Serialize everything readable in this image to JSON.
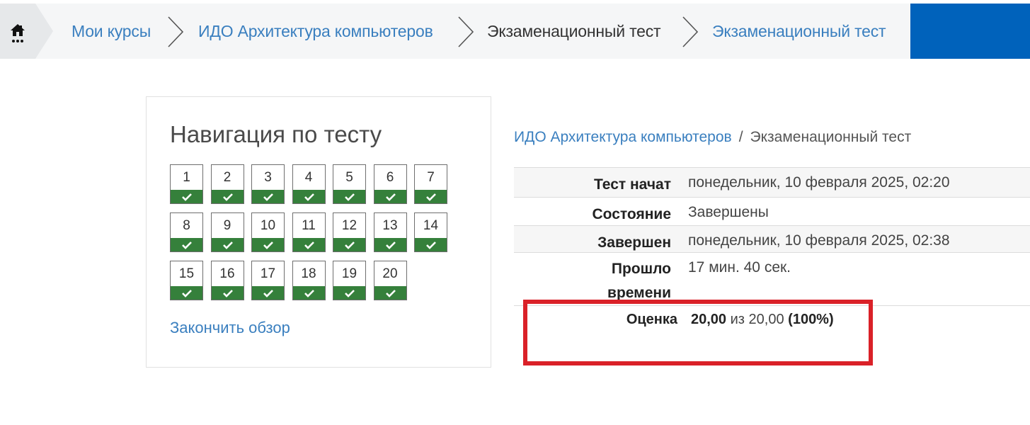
{
  "breadcrumb": {
    "items": [
      {
        "label": "Мои курсы",
        "type": "link"
      },
      {
        "label": "ИДО Архитектура компьютеров",
        "type": "link"
      },
      {
        "label": "Экзаменационный тест",
        "type": "current"
      },
      {
        "label": "Экзаменационный тест",
        "type": "link"
      }
    ]
  },
  "icons": {
    "home": "home-icon",
    "separator": "chevron-right-icon",
    "question_state": "check-icon"
  },
  "colors": {
    "link": "#3a7fbf",
    "brand": "#0062bb",
    "answered": "#35803b",
    "highlight": "#da2128"
  },
  "quiz_navigation": {
    "title": "Навигация по тесту",
    "questions": [
      {
        "number": "1",
        "state": "answered"
      },
      {
        "number": "2",
        "state": "answered"
      },
      {
        "number": "3",
        "state": "answered"
      },
      {
        "number": "4",
        "state": "answered"
      },
      {
        "number": "5",
        "state": "answered"
      },
      {
        "number": "6",
        "state": "answered"
      },
      {
        "number": "7",
        "state": "answered"
      },
      {
        "number": "8",
        "state": "answered"
      },
      {
        "number": "9",
        "state": "answered"
      },
      {
        "number": "10",
        "state": "answered"
      },
      {
        "number": "11",
        "state": "answered"
      },
      {
        "number": "12",
        "state": "answered"
      },
      {
        "number": "13",
        "state": "answered"
      },
      {
        "number": "14",
        "state": "answered"
      },
      {
        "number": "15",
        "state": "answered"
      },
      {
        "number": "16",
        "state": "answered"
      },
      {
        "number": "17",
        "state": "answered"
      },
      {
        "number": "18",
        "state": "answered"
      },
      {
        "number": "19",
        "state": "answered"
      },
      {
        "number": "20",
        "state": "answered"
      }
    ],
    "finish_review": "Закончить обзор"
  },
  "summary": {
    "breadcrumb": {
      "course": "ИДО Архитектура компьютеров",
      "separator": "/",
      "quiz": "Экзаменационный тест"
    },
    "rows": [
      {
        "label": "Тест начат",
        "value": "понедельник, 10 февраля 2025, 02:20"
      },
      {
        "label": "Состояние",
        "value": "Завершены"
      },
      {
        "label": "Завершен",
        "value": "понедельник, 10 февраля 2025, 02:38"
      },
      {
        "label": "Прошло времени",
        "value": "17 мин. 40 сек."
      }
    ],
    "grade": {
      "label": "Оценка",
      "score": "20,00",
      "of_text": "из",
      "max": "20,00",
      "percent": "(100%)"
    }
  }
}
